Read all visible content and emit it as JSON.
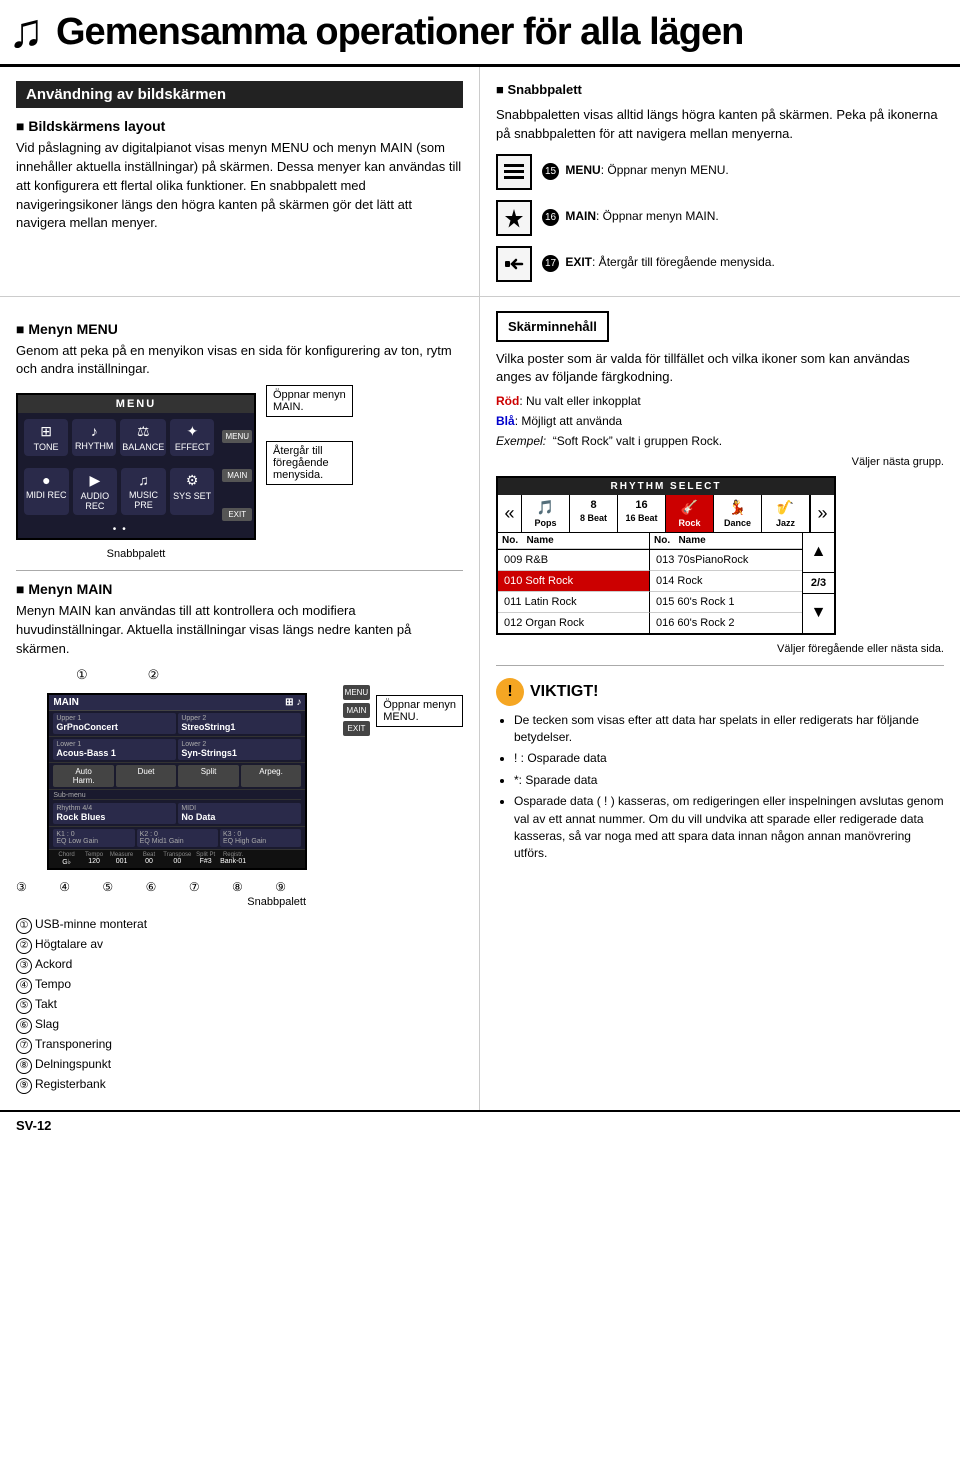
{
  "header": {
    "title": "Gemensamma operationer för alla lägen",
    "music_icon": "♪"
  },
  "left_col": {
    "section1": {
      "title": "Användning av bildskärmen",
      "subsection1": {
        "title": "Bildskärmens layout",
        "text1": "Vid påslagning av digitalpianot visas menyn MENU och menyn MAIN (som innehåller aktuella inställningar) på skärmen. Dessa menyer kan användas till att konfigurera ett flertal olika funktioner. En snabbpalett med navigeringsikoner längs den högra kanten på skärmen gör det lätt att navigera mellan menyer."
      },
      "subsection_menu": {
        "title": "Menyn MENU",
        "text": "Genom att peka på en menyikon visas en sida för konfigurering av ton, rytm och andra inställningar.",
        "menu_title": "MENU",
        "menu_items_top": [
          {
            "icon": "⊞",
            "label": "TONE"
          },
          {
            "icon": "♪",
            "label": "RHYTHM"
          },
          {
            "icon": "⚖",
            "label": "BALANCE"
          },
          {
            "icon": "✦",
            "label": "EFFECT"
          }
        ],
        "menu_items_bottom": [
          {
            "icon": "●",
            "label": "MIDI RECORDER"
          },
          {
            "icon": "▶",
            "label": "AUDIO RECORDER"
          },
          {
            "icon": "♫",
            "label": "MUSIC PRESET"
          },
          {
            "icon": "⚙",
            "label": "SYSTEM SETTING"
          }
        ],
        "callout1": "Öppnar menyn MAIN.",
        "callout2": "Återgår till föregående menysida.",
        "snabbpalett_label": "Snabbpalett"
      },
      "subsection_main": {
        "title": "Menyn MAIN",
        "text1": "Menyn MAIN kan användas till att kontrollera och modifiera huvudinställningar. Aktuella inställningar visas längs nedre kanten på skärmen.",
        "main_title": "MAIN",
        "callout_open_menu": "Öppnar menyn MENU.",
        "snabbpalett_label": "Snabbpalett",
        "upper1_label": "Upper 1",
        "upper1_value": "GrPnoConcert",
        "upper2_label": "Upper 2",
        "upper2_value": "StreoString1",
        "lower1_label": "Lower 1",
        "lower1_value": "Acous-Bass 1",
        "lower2_label": "Lower 2",
        "lower2_value": "Syn-Strings1",
        "buttons": [
          "Auto Harmonize",
          "Duet",
          "Split",
          "Arpeggiator"
        ],
        "submenu_label": "Sub-menu",
        "rhythm_label": "Rhythm 4/4",
        "rhythm_value": "Rock Blues",
        "midi_label": "MIDI",
        "midi_value": "No Data",
        "k1_label": "K1 : 0",
        "k1_sub": "EQ Low Gain",
        "k2_label": "K2 : 0",
        "k2_sub": "EQ Mid1 Gain",
        "k3_label": "K3 : 0",
        "k3_sub": "EQ High Gain",
        "bottom_labels": [
          "Chord",
          "Tempo",
          "Measure",
          "Beat",
          "Transpose",
          "Split Point",
          "Registration"
        ],
        "bottom_values": [
          "G♭",
          "120",
          "001",
          "00",
          "00",
          "F#3",
          "Bank-01"
        ],
        "num1": "①",
        "num2": "②",
        "nums_bottom": "③ ④ ⑤ ⑥ ⑦ ⑧ ⑨"
      },
      "numbered_items": [
        {
          "num": "①",
          "label": "USB-minne monterat"
        },
        {
          "num": "②",
          "label": "Högtalare av"
        },
        {
          "num": "③",
          "label": "Ackord"
        },
        {
          "num": "④",
          "label": "Tempo"
        },
        {
          "num": "⑤",
          "label": "Takt"
        },
        {
          "num": "⑥",
          "label": "Slag"
        },
        {
          "num": "⑦",
          "label": "Transponering"
        },
        {
          "num": "⑧",
          "label": "Delningspunkt"
        },
        {
          "num": "⑨",
          "label": "Registerbank"
        }
      ]
    }
  },
  "right_col": {
    "snabbpalett": {
      "title": "Snabbpalett",
      "text1": "Snabbpaletten visas alltid längs högra kanten på skärmen. Peka på ikonerna på snabbpaletten för att navigera mellan menyerna.",
      "icons": [
        {
          "num": "15",
          "symbol": "⊞",
          "label": "MENU: Öppnar menyn MENU."
        },
        {
          "num": "16",
          "symbol": "♪",
          "label": "MAIN: Öppnar menyn MAIN."
        },
        {
          "num": "17",
          "symbol": "↩",
          "label": "EXIT: Återgår till föregående menysida."
        }
      ]
    },
    "skarminnehall": {
      "title": "Skärminnehåll",
      "text1": "Vilka poster som är valda för tillfället och vilka ikoner som kan användas anges av följande färgkodning.",
      "color_red": "Röd: Nu valt eller inkopplat",
      "color_blue": "Blå: Möjligt att använda",
      "example_label": "Exempel:",
      "example_text": "\"Soft Rock\" valt i gruppen Rock.",
      "next_group": "Väljer nästa grupp.",
      "prev_next_page": "Väljer föregående eller nästa sida.",
      "rhythm_select_title": "RHYTHM SELECT",
      "tabs": [
        {
          "icon": "«",
          "label": ""
        },
        {
          "icon": "🥁",
          "label": "Pops"
        },
        {
          "icon": "8",
          "label": "8 Beat"
        },
        {
          "icon": "16",
          "label": "16 Beat"
        },
        {
          "icon": "🎸",
          "label": "Rock",
          "selected": true
        },
        {
          "icon": "💃",
          "label": "Dance"
        },
        {
          "icon": "🎷",
          "label": "Jazz"
        },
        {
          "icon": "»",
          "label": ""
        }
      ],
      "rhythm_list": [
        {
          "no": "009",
          "name": "R&B",
          "no2": "013",
          "name2": "70sPianoRock"
        },
        {
          "no": "010",
          "name": "Soft Rock",
          "no2": "014",
          "name2": "Rock",
          "selected": true
        },
        {
          "no": "011",
          "name": "Latin Rock",
          "no2": "015",
          "name2": "60's Rock 1"
        },
        {
          "no": "012",
          "name": "Organ Rock",
          "no2": "016",
          "name2": "60's Rock 2"
        }
      ],
      "page_indicator": "2/3"
    },
    "viktigt": {
      "title": "VIKTIGT!",
      "bullets": [
        "De tecken som visas efter att data har spelats in eller redigerats har följande betydelser.",
        "! : Osparade data",
        "*: Sparade data",
        "Osparade data ( ! ) kasseras, om redigeringen eller inspelningen avslutas genom val av ett annat nummer. Om du vill undvika att sparade eller redigerade data kasseras, så var noga med att spara data innan någon annan manövrering utförs."
      ]
    }
  },
  "footer": {
    "page": "SV-12"
  }
}
